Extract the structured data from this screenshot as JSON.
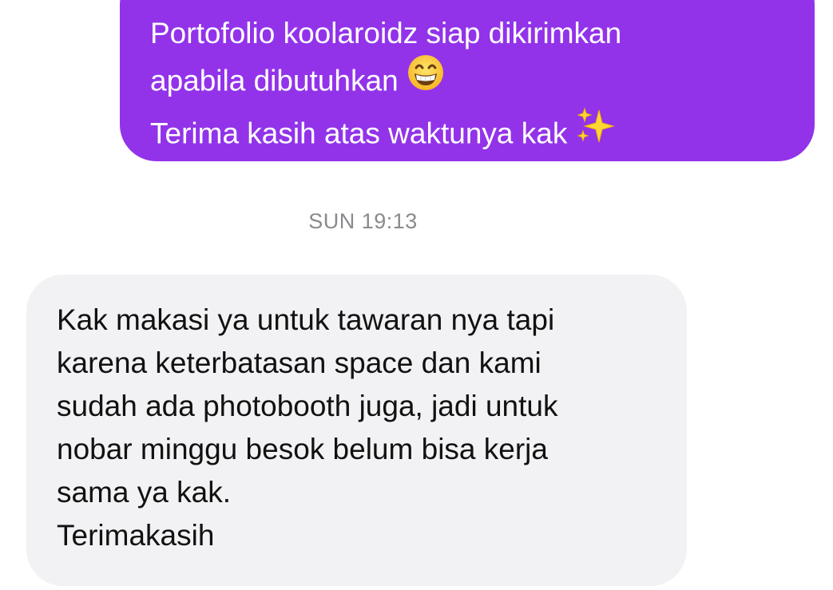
{
  "conversation": {
    "outgoing_message": {
      "lines": [
        "Portofolio koolaroidz siap dikirimkan",
        "apabila dibutuhkan",
        "Terima kasih atas waktunya kak"
      ],
      "emojis": [
        "grinning-face-with-smiling-eyes",
        "sparkles"
      ],
      "bubble_color": "#9233ea",
      "text_color": "#ffffff"
    },
    "timestamp": "SUN 19:13",
    "incoming_message": {
      "lines": [
        "Kak makasi ya untuk tawaran nya tapi",
        "karena keterbatasan space dan kami",
        "sudah ada photobooth juga, jadi untuk",
        "nobar minggu besok belum bisa kerja",
        "sama ya kak.",
        "Terimakasih"
      ],
      "bubble_color": "#f2f2f4",
      "text_color": "#111111"
    }
  }
}
